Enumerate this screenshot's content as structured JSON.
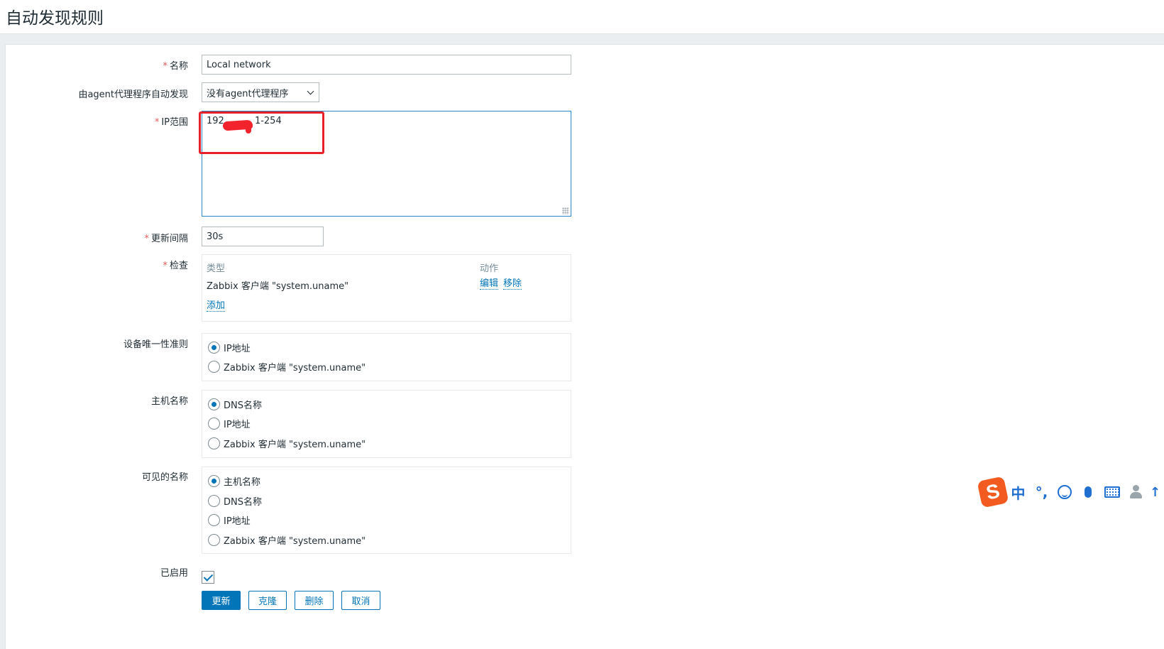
{
  "page": {
    "title": "自动发现规则"
  },
  "form": {
    "required_mark": "*",
    "name": {
      "label": "名称",
      "value": "Local network"
    },
    "proxy": {
      "label": "由agent代理程序自动发现",
      "value": "没有agent代理程序"
    },
    "ip_range": {
      "label": "IP范围",
      "value_start": "192.",
      "value_end": "1-254"
    },
    "interval": {
      "label": "更新间隔",
      "value": "30s"
    },
    "checks": {
      "label": "检查",
      "col_type": "类型",
      "col_action": "动作",
      "rows": [
        {
          "type": "Zabbix 客户端 \"system.uname\"",
          "edit": "编辑",
          "remove": "移除"
        }
      ],
      "add": "添加"
    },
    "uniqueness": {
      "label": "设备唯一性准则",
      "options": [
        "IP地址",
        "Zabbix 客户端 \"system.uname\""
      ],
      "selected": 0
    },
    "host_name": {
      "label": "主机名称",
      "options": [
        "DNS名称",
        "IP地址",
        "Zabbix 客户端 \"system.uname\""
      ],
      "selected": 0
    },
    "visible_name": {
      "label": "可见的名称",
      "options": [
        "主机名称",
        "DNS名称",
        "IP地址",
        "Zabbix 客户端 \"system.uname\""
      ],
      "selected": 0
    },
    "enabled": {
      "label": "已启用",
      "checked": true
    },
    "buttons": {
      "update": "更新",
      "clone": "克隆",
      "delete": "删除",
      "cancel": "取消"
    }
  },
  "ime_toolbar": {
    "logo": "S",
    "mode": "中",
    "punct": "°,",
    "icons": [
      "smile-icon",
      "microphone-icon",
      "keyboard-icon",
      "user-icon",
      "arrow-icon"
    ]
  },
  "colors": {
    "accent": "#0275b8",
    "required": "#e45959",
    "annotation_red": "#e8202a"
  }
}
